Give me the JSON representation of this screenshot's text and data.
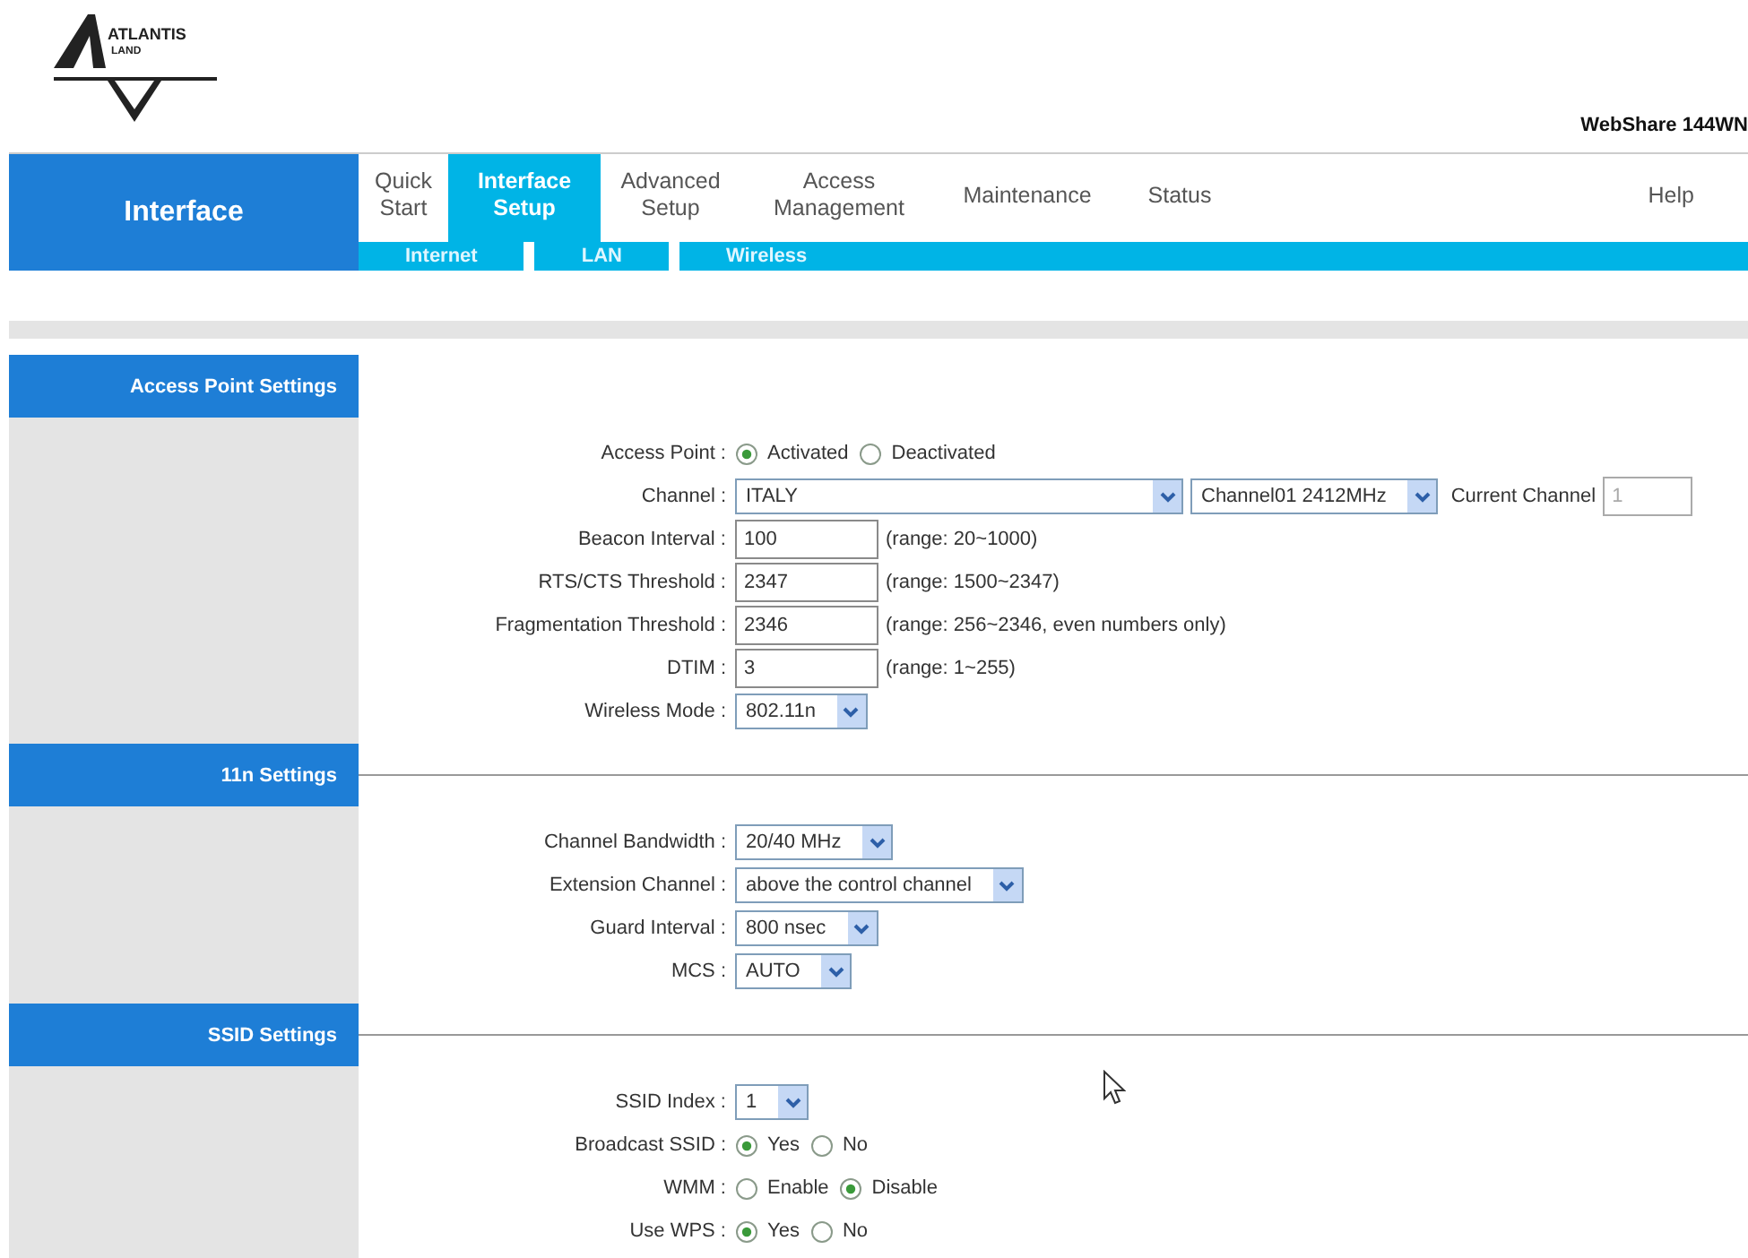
{
  "logo": {
    "text": "ATLANTIS",
    "subtext": "LAND"
  },
  "model": "WebShare 144WN",
  "section_title": "Interface",
  "tabs": [
    {
      "lines": [
        "Quick",
        "Start"
      ],
      "selected": false
    },
    {
      "lines": [
        "Interface",
        "Setup"
      ],
      "selected": true
    },
    {
      "lines": [
        "Advanced",
        "Setup"
      ],
      "selected": false
    },
    {
      "lines": [
        "Access",
        "Management"
      ],
      "selected": false
    },
    {
      "lines": [
        "Maintenance"
      ],
      "selected": false
    },
    {
      "lines": [
        "Status"
      ],
      "selected": false
    },
    {
      "lines": [
        "Help"
      ],
      "selected": false
    }
  ],
  "subtabs": [
    {
      "label": "Internet"
    },
    {
      "label": "LAN"
    },
    {
      "label": "Wireless"
    }
  ],
  "sections": [
    {
      "title": "Access Point Settings",
      "rows": [
        {
          "kind": "radio",
          "label": "Access Point :",
          "options": [
            {
              "label": "Activated",
              "selected": true
            },
            {
              "label": "Deactivated",
              "selected": false
            }
          ]
        },
        {
          "kind": "channel",
          "label": "Channel :",
          "country": "ITALY",
          "channel": "Channel01 2412MHz",
          "current_label": "Current Channel",
          "current": "1"
        },
        {
          "kind": "text",
          "label": "Beacon Interval :",
          "value": "100",
          "hint": "(range: 20~1000)"
        },
        {
          "kind": "text",
          "label": "RTS/CTS Threshold :",
          "value": "2347",
          "hint": "(range: 1500~2347)"
        },
        {
          "kind": "text",
          "label": "Fragmentation Threshold :",
          "value": "2346",
          "hint": "(range: 256~2346, even numbers only)"
        },
        {
          "kind": "text",
          "label": "DTIM :",
          "value": "3",
          "hint": "(range: 1~255)"
        },
        {
          "kind": "select",
          "label": "Wireless Mode :",
          "value": "802.11n"
        }
      ]
    },
    {
      "title": "11n Settings",
      "rows": [
        {
          "kind": "select",
          "label": "Channel Bandwidth :",
          "value": "20/40 MHz"
        },
        {
          "kind": "select",
          "label": "Extension Channel :",
          "value": "above the control channel"
        },
        {
          "kind": "select",
          "label": "Guard Interval :",
          "value": "800 nsec"
        },
        {
          "kind": "select",
          "label": "MCS :",
          "value": "AUTO"
        }
      ]
    },
    {
      "title": "SSID Settings",
      "rows": [
        {
          "kind": "select",
          "label": "SSID Index :",
          "value": "1"
        },
        {
          "kind": "radio",
          "label": "Broadcast SSID :",
          "options": [
            {
              "label": "Yes",
              "selected": true
            },
            {
              "label": "No",
              "selected": false
            }
          ]
        },
        {
          "kind": "radio",
          "label": "WMM :",
          "options": [
            {
              "label": "Enable",
              "selected": false
            },
            {
              "label": "Disable",
              "selected": true
            }
          ]
        },
        {
          "kind": "radio",
          "label": "Use WPS :",
          "options": [
            {
              "label": "Yes",
              "selected": true
            },
            {
              "label": "No",
              "selected": false
            }
          ]
        }
      ]
    }
  ]
}
